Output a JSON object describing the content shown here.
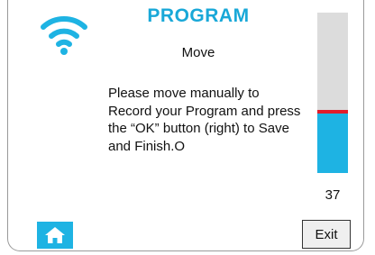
{
  "header": {
    "title": "PROGRAM",
    "subtitle": "Move",
    "wifi_icon": "wifi-icon"
  },
  "message": "Please move manually to\nRecord your Program and press\nthe “OK” button (right) to Save\nand Finish.O",
  "level": {
    "value": "37",
    "fill_fraction": 0.37,
    "marker_fraction": 0.37,
    "colors": {
      "fill": "#1eb3e3",
      "track": "#dcdcdc",
      "marker": "#e21d2b"
    }
  },
  "footer": {
    "home_icon": "home-icon",
    "exit_label": "Exit"
  },
  "colors": {
    "accent": "#19a8d8",
    "button": "#1eb3e3"
  }
}
